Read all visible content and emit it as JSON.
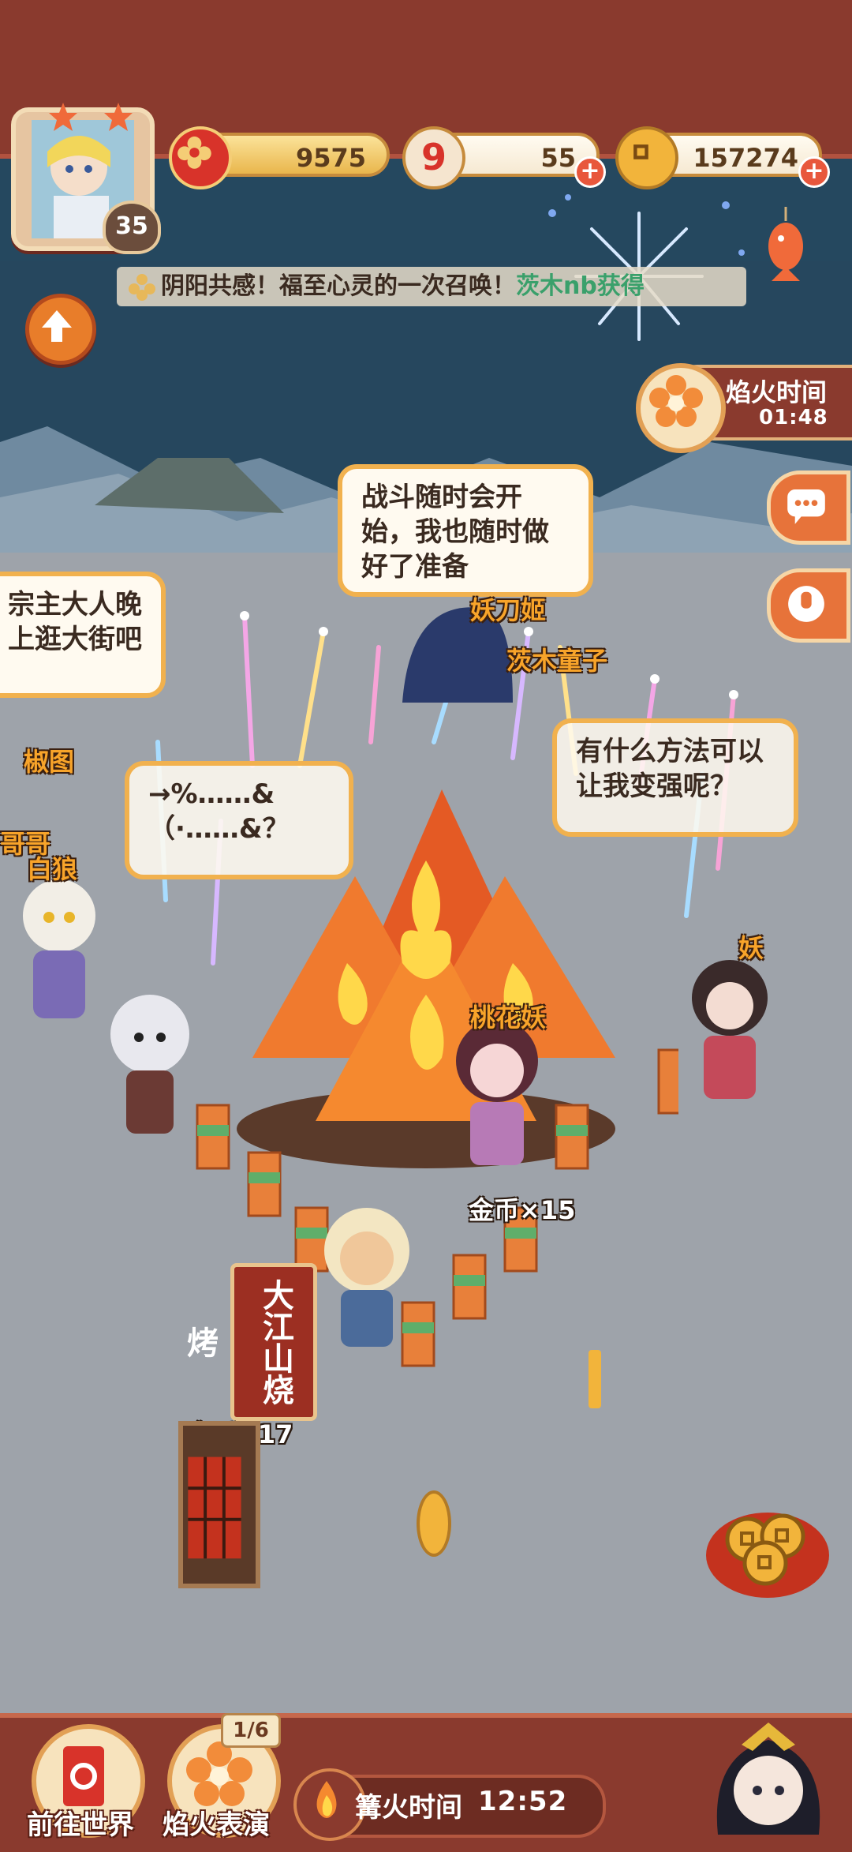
{
  "player": {
    "level": "35"
  },
  "currencies": [
    {
      "icon": "magatama-flower-icon",
      "value": "9575"
    },
    {
      "icon": "scroll-nine-icon",
      "value": "55"
    },
    {
      "icon": "gold-coin-icon",
      "value": "157274"
    }
  ],
  "marquee": {
    "text": "阴阳共感！福至心灵的一次召唤！",
    "highlight": "茨木nb获得"
  },
  "fire_time": {
    "label": "焰火时间",
    "value": "01:48"
  },
  "bubbles": {
    "b1": "战斗随时会开始，我也随时做好了准备",
    "b2": "宗主大人晚上逛大街吧",
    "b3": "→%……&（·……&？",
    "b4": "有什么方法可以让我变强呢？"
  },
  "name_tags": {
    "yaodaoji": "妖刀姬",
    "ibaraki": "茨木童子",
    "jiaotu": "椒图",
    "gege": "哥哥",
    "bailang": "白狼",
    "taohuayao": "桃花妖",
    "yao": "妖"
  },
  "stall": {
    "banner": "大江山烧烤",
    "coins_text": "金币×17"
  },
  "bonfire_coins": "金币×15",
  "bottom": {
    "world_label": "前往世界",
    "fireworks_label": "焰火表演",
    "fireworks_count": "1/6",
    "campfire_label": "篝火时间",
    "campfire_time": "12:52"
  },
  "colors": {
    "top_band": "#8a3a2e",
    "sky": "#26475e",
    "ground": "#9ea3aa",
    "accent_orange": "#f1b14e",
    "tag_orange": "#f8a42a"
  }
}
